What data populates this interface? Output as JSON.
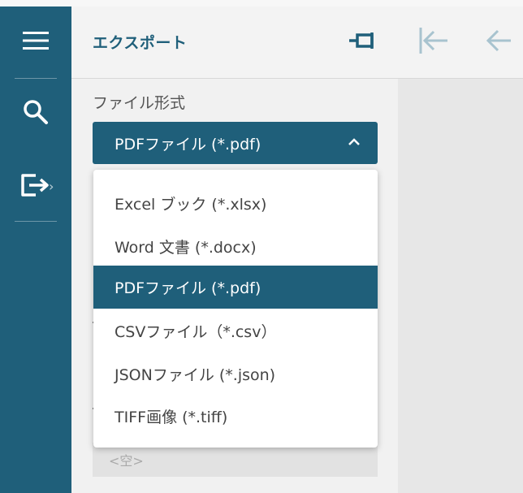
{
  "panel": {
    "title": "エクスポート"
  },
  "rail": {
    "items": [
      {
        "icon": "menu-icon"
      },
      {
        "icon": "search-icon"
      },
      {
        "icon": "export-icon"
      }
    ]
  },
  "form": {
    "file_format_label": "ファイル形式",
    "selected_value": "PDFファイル (*.pdf)",
    "empty_placeholder": "<空>"
  },
  "dropdown": {
    "options": [
      {
        "label": "Excel ブック (*.xlsx)",
        "selected": false
      },
      {
        "label": "Word 文書 (*.docx)",
        "selected": false
      },
      {
        "label": "PDFファイル (*.pdf)",
        "selected": true
      },
      {
        "label": "CSVファイル（*.csv）",
        "selected": false
      },
      {
        "label": "JSONファイル (*.json)",
        "selected": false
      },
      {
        "label": "TIFF画像 (*.tiff)",
        "selected": false
      }
    ]
  },
  "colors": {
    "accent": "#1f5f7a",
    "icon_muted": "#a8c3cf"
  }
}
